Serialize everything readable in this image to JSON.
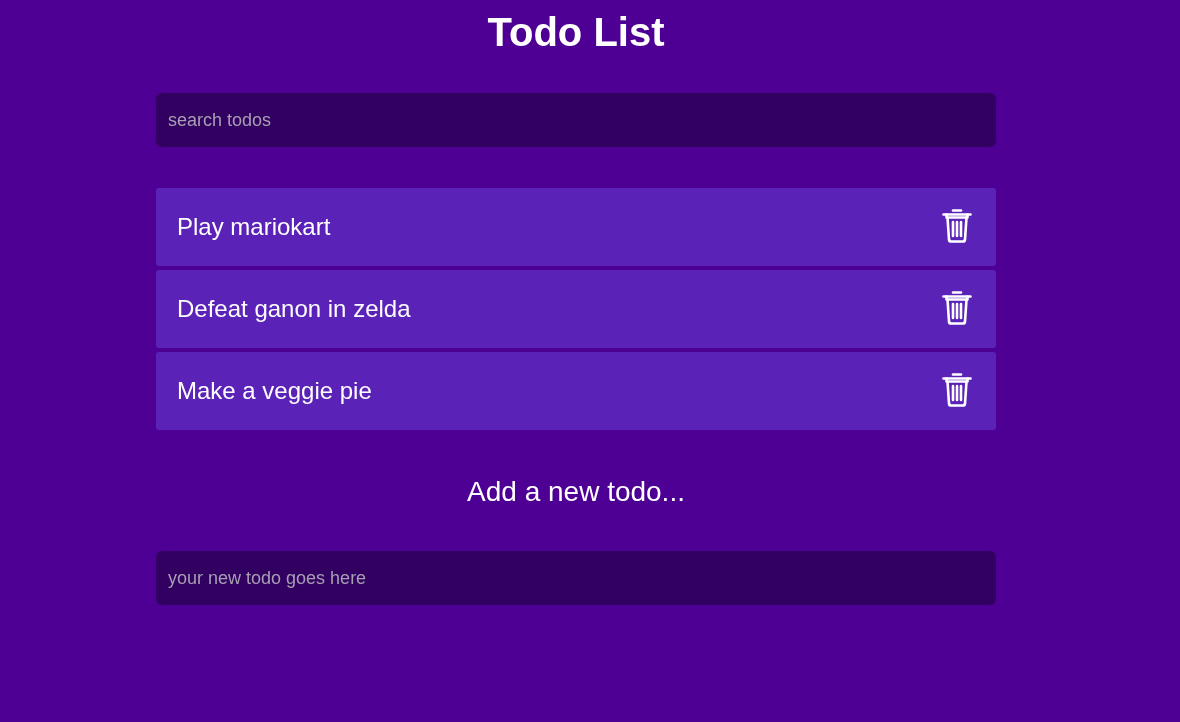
{
  "title": "Todo List",
  "search": {
    "placeholder": "search todos"
  },
  "todos": [
    {
      "text": "Play mariokart"
    },
    {
      "text": "Defeat ganon in zelda"
    },
    {
      "text": "Make a veggie pie"
    }
  ],
  "add_form": {
    "heading": "Add a new todo...",
    "placeholder": "your new todo goes here"
  }
}
